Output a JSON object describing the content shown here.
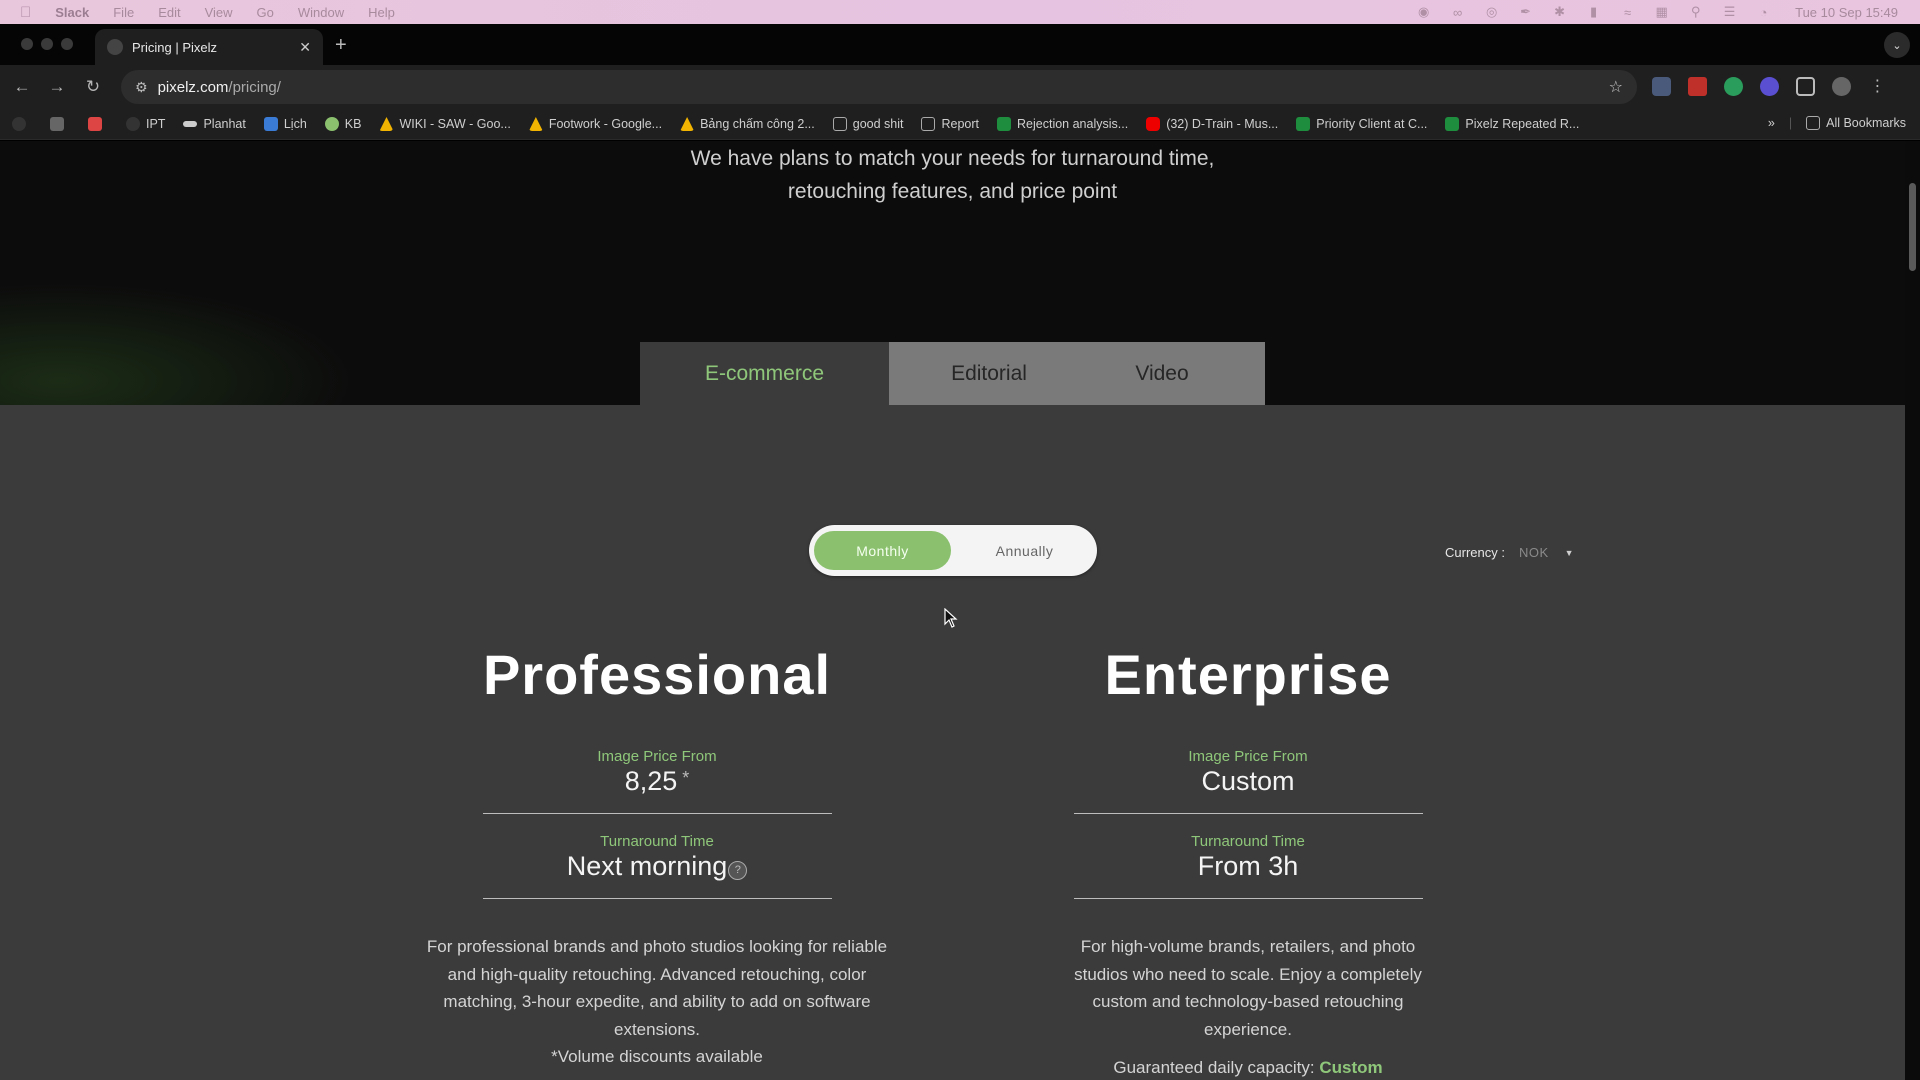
{
  "menubar": {
    "app": "Slack",
    "items": [
      "File",
      "Edit",
      "View",
      "Go",
      "Window",
      "Help"
    ],
    "clock": "Tue 10 Sep  15:49"
  },
  "browser": {
    "tab_title": "Pricing | Pixelz",
    "url_host": "pixelz.com",
    "url_path": "/pricing/",
    "bookmarks": [
      "IPT",
      "Planhat",
      "Lịch",
      "KB",
      "WIKI - SAW - Goo...",
      "Footwork - Google...",
      "Bảng chấm công 2...",
      "good shit",
      "Report",
      "Rejection analysis...",
      "(32) D-Train - Mus...",
      "Priority Client at C...",
      "Pixelz Repeated R..."
    ],
    "all_bookmarks": "All Bookmarks"
  },
  "hero": {
    "line1": "We have plans to match your needs for turnaround time,",
    "line2": "retouching features, and price point"
  },
  "tabs": [
    "E-commerce",
    "Editorial",
    "Video"
  ],
  "billing": {
    "monthly": "Monthly",
    "annually": "Annually"
  },
  "currency": {
    "label": "Currency :",
    "value": "NOK"
  },
  "plans": {
    "professional": {
      "name": "Professional",
      "price_label": "Image Price From",
      "price": "8,25",
      "price_mark": "*",
      "turnaround_label": "Turnaround Time",
      "turnaround": "Next morning",
      "help": "?",
      "description": "For professional brands and photo studios looking for reliable and high-quality retouching. Advanced retouching, color matching, 3-hour expedite, and ability to add on software extensions.",
      "note": "*Volume discounts available"
    },
    "enterprise": {
      "name": "Enterprise",
      "price_label": "Image Price From",
      "price": "Custom",
      "turnaround_label": "Turnaround Time",
      "turnaround": "From 3h",
      "description": "For high-volume brands, retailers, and photo studios who need to scale. Enjoy a completely custom and technology-based retouching experience.",
      "capacity_label": "Guaranteed daily capacity:",
      "capacity_value": "Custom"
    }
  },
  "colors": {
    "accent_green": "#8fc77a",
    "page_bg": "#3b3b3b",
    "hero_bg": "#0c0c0c"
  }
}
